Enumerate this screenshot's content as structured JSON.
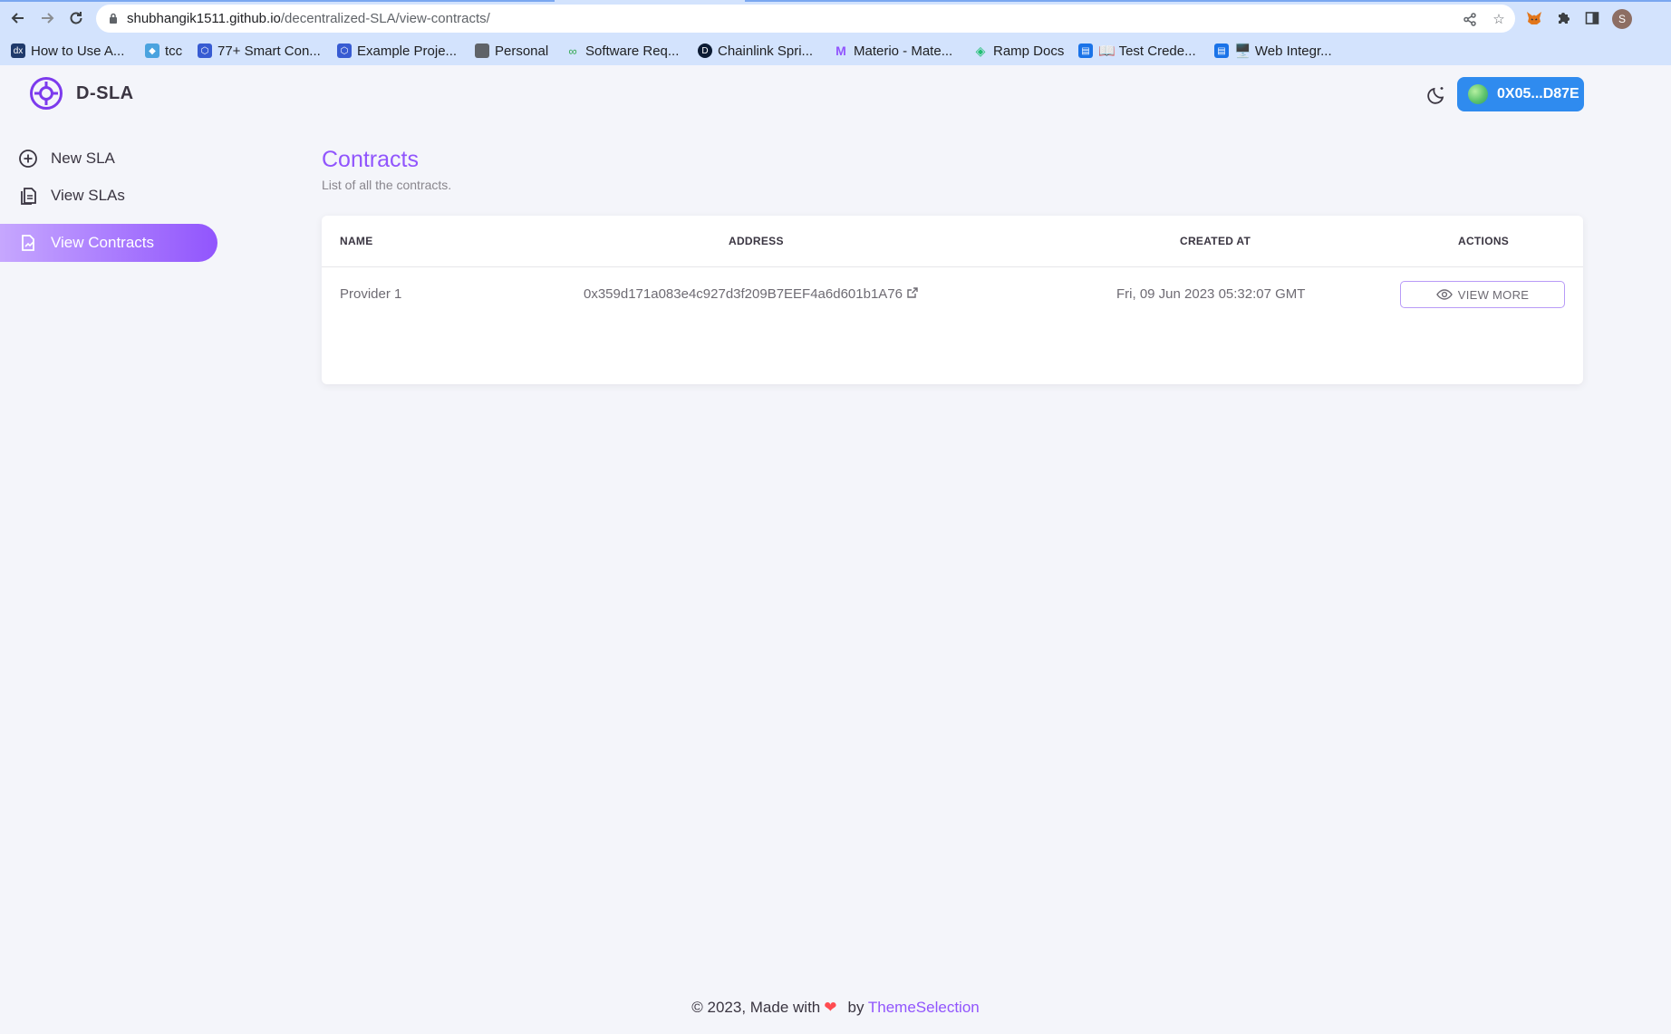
{
  "browser": {
    "url_host": "shubhangik1511.github.io",
    "url_path": "/decentralized-SLA/view-contracts/",
    "profile_initial": "S",
    "bookmarks": [
      {
        "label": "How to Use A...",
        "icon": "ddx-icon",
        "color": "#1f3a6b"
      },
      {
        "label": "tcc",
        "icon": "cube-icon",
        "color": "#4aa3df"
      },
      {
        "label": "77+ Smart Con...",
        "icon": "chainlink-icon",
        "color": "#375bd2"
      },
      {
        "label": "Example Proje...",
        "icon": "chainlink-icon",
        "color": "#375bd2"
      },
      {
        "label": "Personal",
        "icon": "folder-icon",
        "color": "#5f6368"
      },
      {
        "label": "Software Req...",
        "icon": "glasses-icon",
        "color": "#34a853"
      },
      {
        "label": "Chainlink Spri...",
        "icon": "d-circle-icon",
        "color": "#0c1b33"
      },
      {
        "label": "Materio - Mate...",
        "icon": "materio-icon",
        "color": "#9155fd"
      },
      {
        "label": "Ramp Docs",
        "icon": "ramp-icon",
        "color": "#21bf73"
      },
      {
        "label": "📖 Test Crede...",
        "icon": "book-icon",
        "color": "#1a73e8"
      },
      {
        "label": "🖥️ Web Integr...",
        "icon": "book-icon",
        "color": "#1a73e8"
      }
    ]
  },
  "app": {
    "brand": "D-SLA",
    "wallet_label": "0X05...D87E",
    "colors": {
      "primary": "#9155fd",
      "wallet": "#2f8bef",
      "heart": "#ff4c51"
    }
  },
  "sidebar": {
    "items": [
      {
        "label": "New SLA",
        "icon": "plus-circle-icon",
        "active": false
      },
      {
        "label": "View SLAs",
        "icon": "document-icon",
        "active": false
      },
      {
        "label": "View Contracts",
        "icon": "file-chart-icon",
        "active": true
      }
    ]
  },
  "main": {
    "title": "Contracts",
    "subtitle": "List of all the contracts.",
    "table": {
      "columns": [
        "NAME",
        "ADDRESS",
        "CREATED AT",
        "ACTIONS"
      ],
      "rows": [
        {
          "name": "Provider 1",
          "address": "0x359d171a083e4c927d3f209B7EEF4a6d601b1A76",
          "created_at": "Fri, 09 Jun 2023 05:32:07 GMT",
          "action": "VIEW MORE"
        }
      ]
    }
  },
  "footer": {
    "prefix": "© 2023, Made with",
    "by": "by",
    "link": "ThemeSelection"
  }
}
